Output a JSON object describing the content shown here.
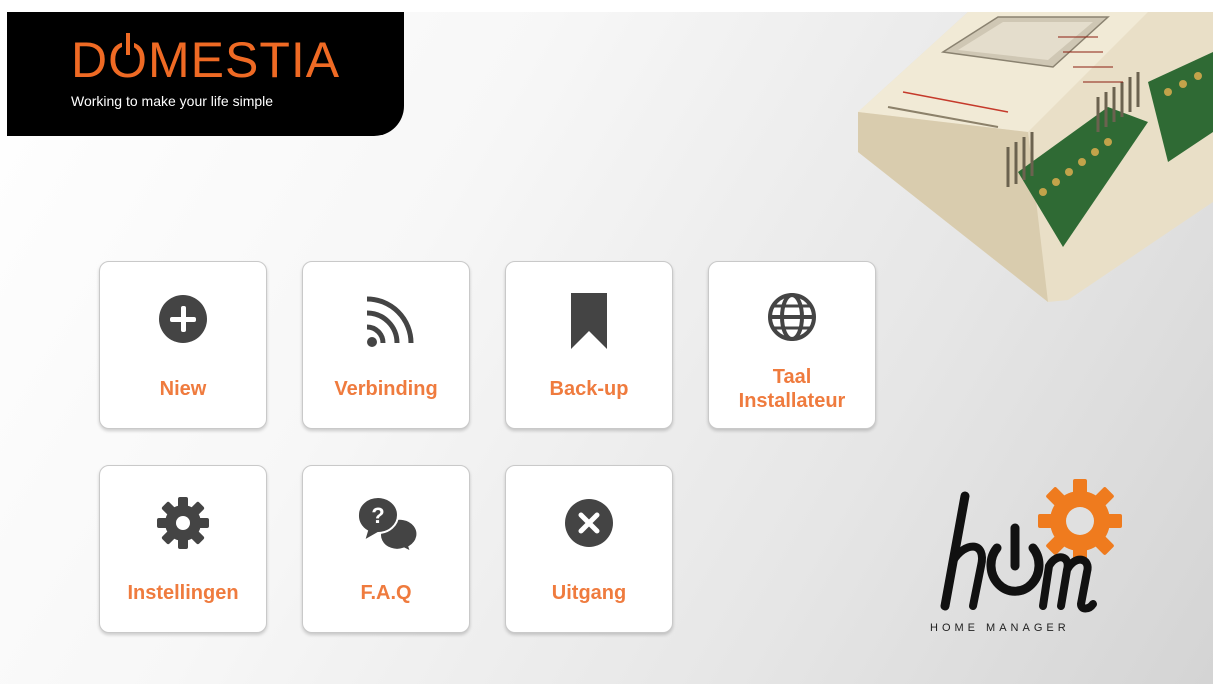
{
  "brand": {
    "logo_text": "DOMESTIA",
    "tagline": "Working to make your life simple",
    "accent_color": "#ef6a24"
  },
  "menu": {
    "label_color": "#ef7b3e",
    "icon_color": "#444444",
    "items": [
      {
        "label": "Niew",
        "icon": "plus-circle-icon"
      },
      {
        "label": "Verbinding",
        "icon": "wifi-signal-icon"
      },
      {
        "label": "Back-up",
        "icon": "bookmark-icon"
      },
      {
        "label": "Taal Installateur",
        "icon": "globe-icon"
      },
      {
        "label": "Instellingen",
        "icon": "gear-icon"
      },
      {
        "label": "F.A.Q",
        "icon": "question-chat-icon"
      },
      {
        "label": "Uitgang",
        "icon": "close-circle-icon"
      }
    ]
  },
  "product": {
    "logo_text": "hOm",
    "subtitle": "HOME MANAGER"
  }
}
